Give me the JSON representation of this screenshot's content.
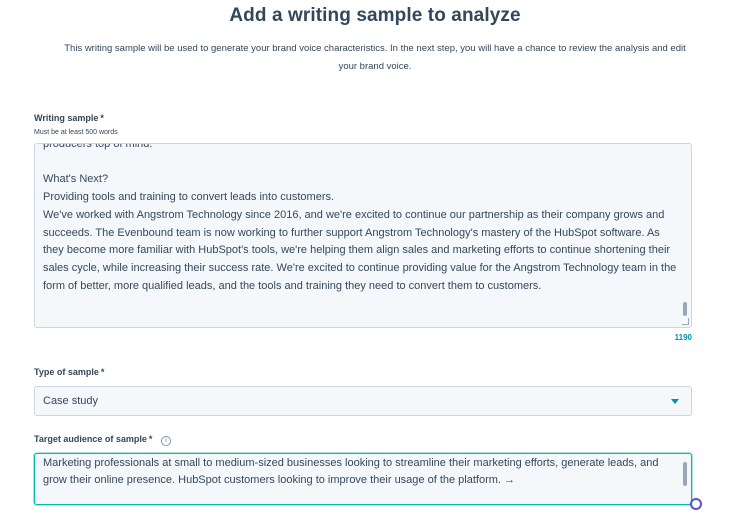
{
  "header": {
    "title": "Add a writing sample to analyze",
    "subtitle": "This writing sample will be used to generate your brand voice characteristics. In the next step, you will have a chance to review the analysis and edit your brand voice."
  },
  "writing_sample": {
    "label": "Writing sample",
    "required_marker": "*",
    "help_text": "Must be at least 500 words",
    "value": "producers top of mind.\n\nWhat's Next?\nProviding tools and training to convert leads into customers.\nWe've worked with Angstrom Technology since 2016, and we're excited to continue our partnership as their company grows and succeeds. The Evenbound team is now working to further support Angstrom Technology's mastery of the HubSpot software. As they become more familiar with HubSpot's tools, we're helping them align sales and marketing efforts to continue shortening their sales cycle, while increasing their success rate. We're excited to continue providing value for the Angstrom Technology team in the form of better, more qualified leads, and the tools and training they need to convert them to customers.",
    "word_count": "1190"
  },
  "sample_type": {
    "label": "Type of sample",
    "required_marker": "*",
    "selected": "Case study"
  },
  "target_audience": {
    "label": "Target audience of sample",
    "required_marker": "*",
    "value": "Marketing professionals at small to medium-sized businesses looking to streamline their marketing efforts, generate leads, and grow their online presence. HubSpot customers looking to improve their usage of the platform. →"
  },
  "icons": {
    "info": "info-icon",
    "dropdown": "chevron-down-icon",
    "loading": "loading-spinner-icon"
  },
  "colors": {
    "text": "#33475b",
    "accent": "#0091ae",
    "focus_border": "#00bda5",
    "field_background": "#f5f8fa"
  }
}
